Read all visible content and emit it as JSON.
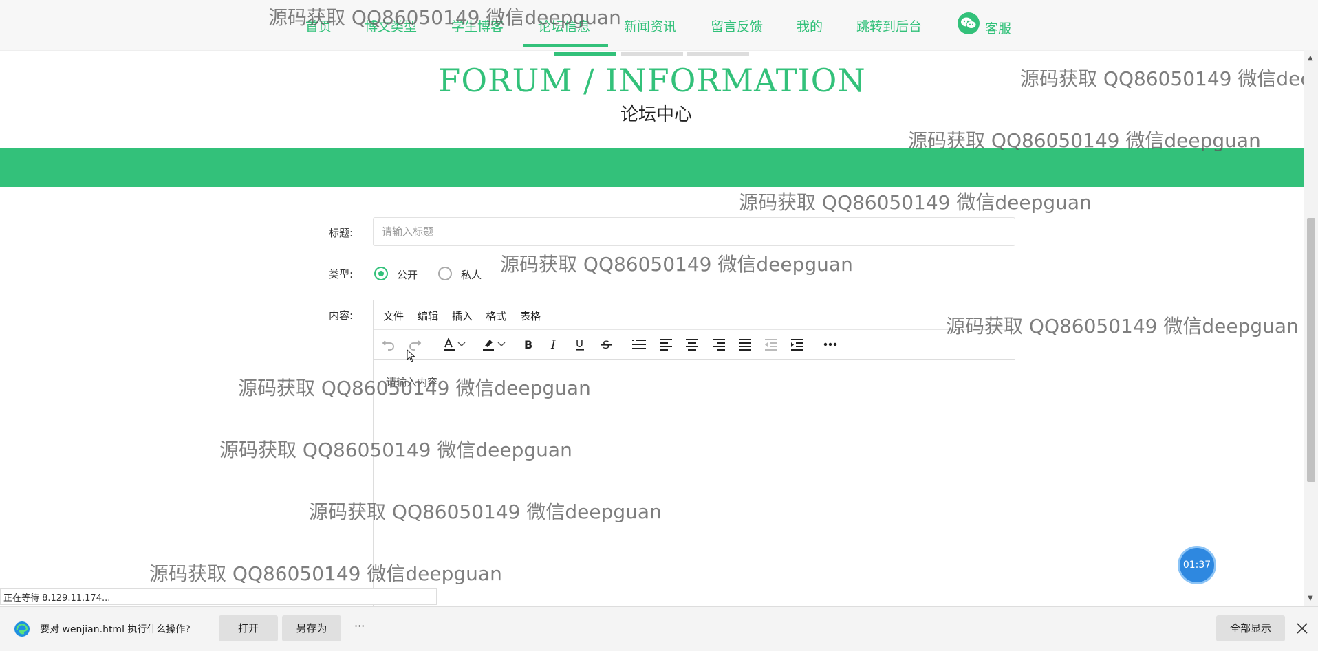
{
  "nav": {
    "items": [
      "首页",
      "博文类型",
      "学生博客",
      "论坛信息",
      "新闻资讯",
      "留言反馈",
      "我的",
      "跳转到后台"
    ],
    "service": "客服"
  },
  "hero": {
    "title": "FORUM / INFORMATION",
    "subtitle": "论坛中心"
  },
  "form": {
    "title_label": "标题:",
    "title_placeholder": "请输入标题",
    "type_label": "类型:",
    "type_options": [
      "公开",
      "私人"
    ],
    "type_selected": "公开",
    "content_label": "内容:"
  },
  "editor": {
    "menus": [
      "文件",
      "编辑",
      "插入",
      "格式",
      "表格"
    ],
    "placeholder": "请输入内容"
  },
  "watermark": "源码获取 QQ86050149 微信deepguan",
  "timer": "01:37",
  "status_text": "正在等待 8.129.11.174...",
  "download": {
    "prompt": "要对 wenjian.html 执行什么操作?",
    "open": "打开",
    "save_as": "另存为",
    "more": "···",
    "show_all": "全部显示"
  },
  "colors": {
    "brand_green": "#33c17a",
    "timer_blue": "#2e88e0"
  }
}
